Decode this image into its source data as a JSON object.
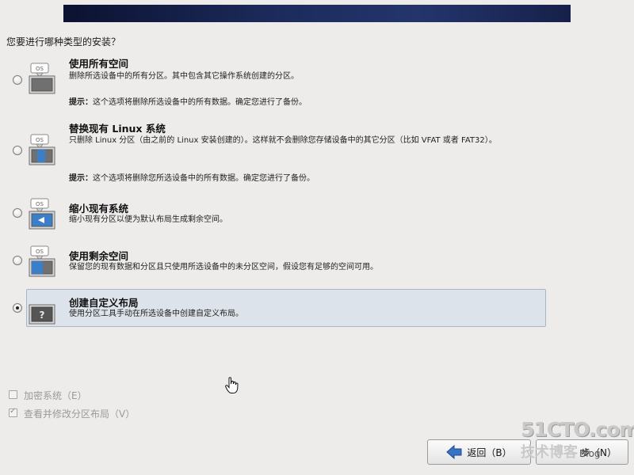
{
  "prompt": "您要进行哪种类型的安装？",
  "options": [
    {
      "title": "使用所有空间",
      "desc": "删除所选设备中的所有分区。其中包含其它操作系统创建的分区。",
      "note_label": "提示：",
      "note_text": "这个选项将删除所选设备中的所有数据。确定您进行了备份。",
      "icon": "os-disk-use-all-icon",
      "icon_text": "OS",
      "selected": false
    },
    {
      "title": "替换现有 Linux 系统",
      "desc": "只删除 Linux 分区（由之前的 Linux 安装创建的）。这样就不会删除您存储设备中的其它分区（比如 VFAT 或者 FAT32）。",
      "note_label": "提示：",
      "note_text": "这个选项将删除您所选设备中的所有数据。确定您进行了备份。",
      "icon": "os-disk-replace-icon",
      "icon_text": "OS",
      "selected": false
    },
    {
      "title": "缩小现有系统",
      "desc": "缩小现有分区以便为默认布局生成剩余空间。",
      "icon": "os-disk-shrink-icon",
      "icon_text": "OS",
      "selected": false
    },
    {
      "title": "使用剩余空间",
      "desc": "保留您的现有数据和分区且只使用所选设备中的未分区空间，假设您有足够的空间可用。",
      "icon": "os-disk-free-space-icon",
      "icon_text": "OS",
      "selected": false
    },
    {
      "title": "创建自定义布局",
      "desc": "使用分区工具手动在所选设备中创建自定义布局。",
      "icon": "custom-layout-icon",
      "icon_text": "?",
      "selected": true
    }
  ],
  "checkboxes": [
    {
      "label": "加密系统（E）",
      "checked": false
    },
    {
      "label": "查看并修改分区布局（V）",
      "checked": true
    }
  ],
  "buttons": {
    "back_label": "返回（B）",
    "next_label": "步（N）"
  },
  "watermark": {
    "line1": "51CTO.com",
    "line2": "技术博客",
    "line3": "Blog"
  },
  "colors": {
    "banner": "#1b2a5a",
    "selected_bg": "#dde3ea",
    "icon_blue": "#3a7fc8"
  }
}
